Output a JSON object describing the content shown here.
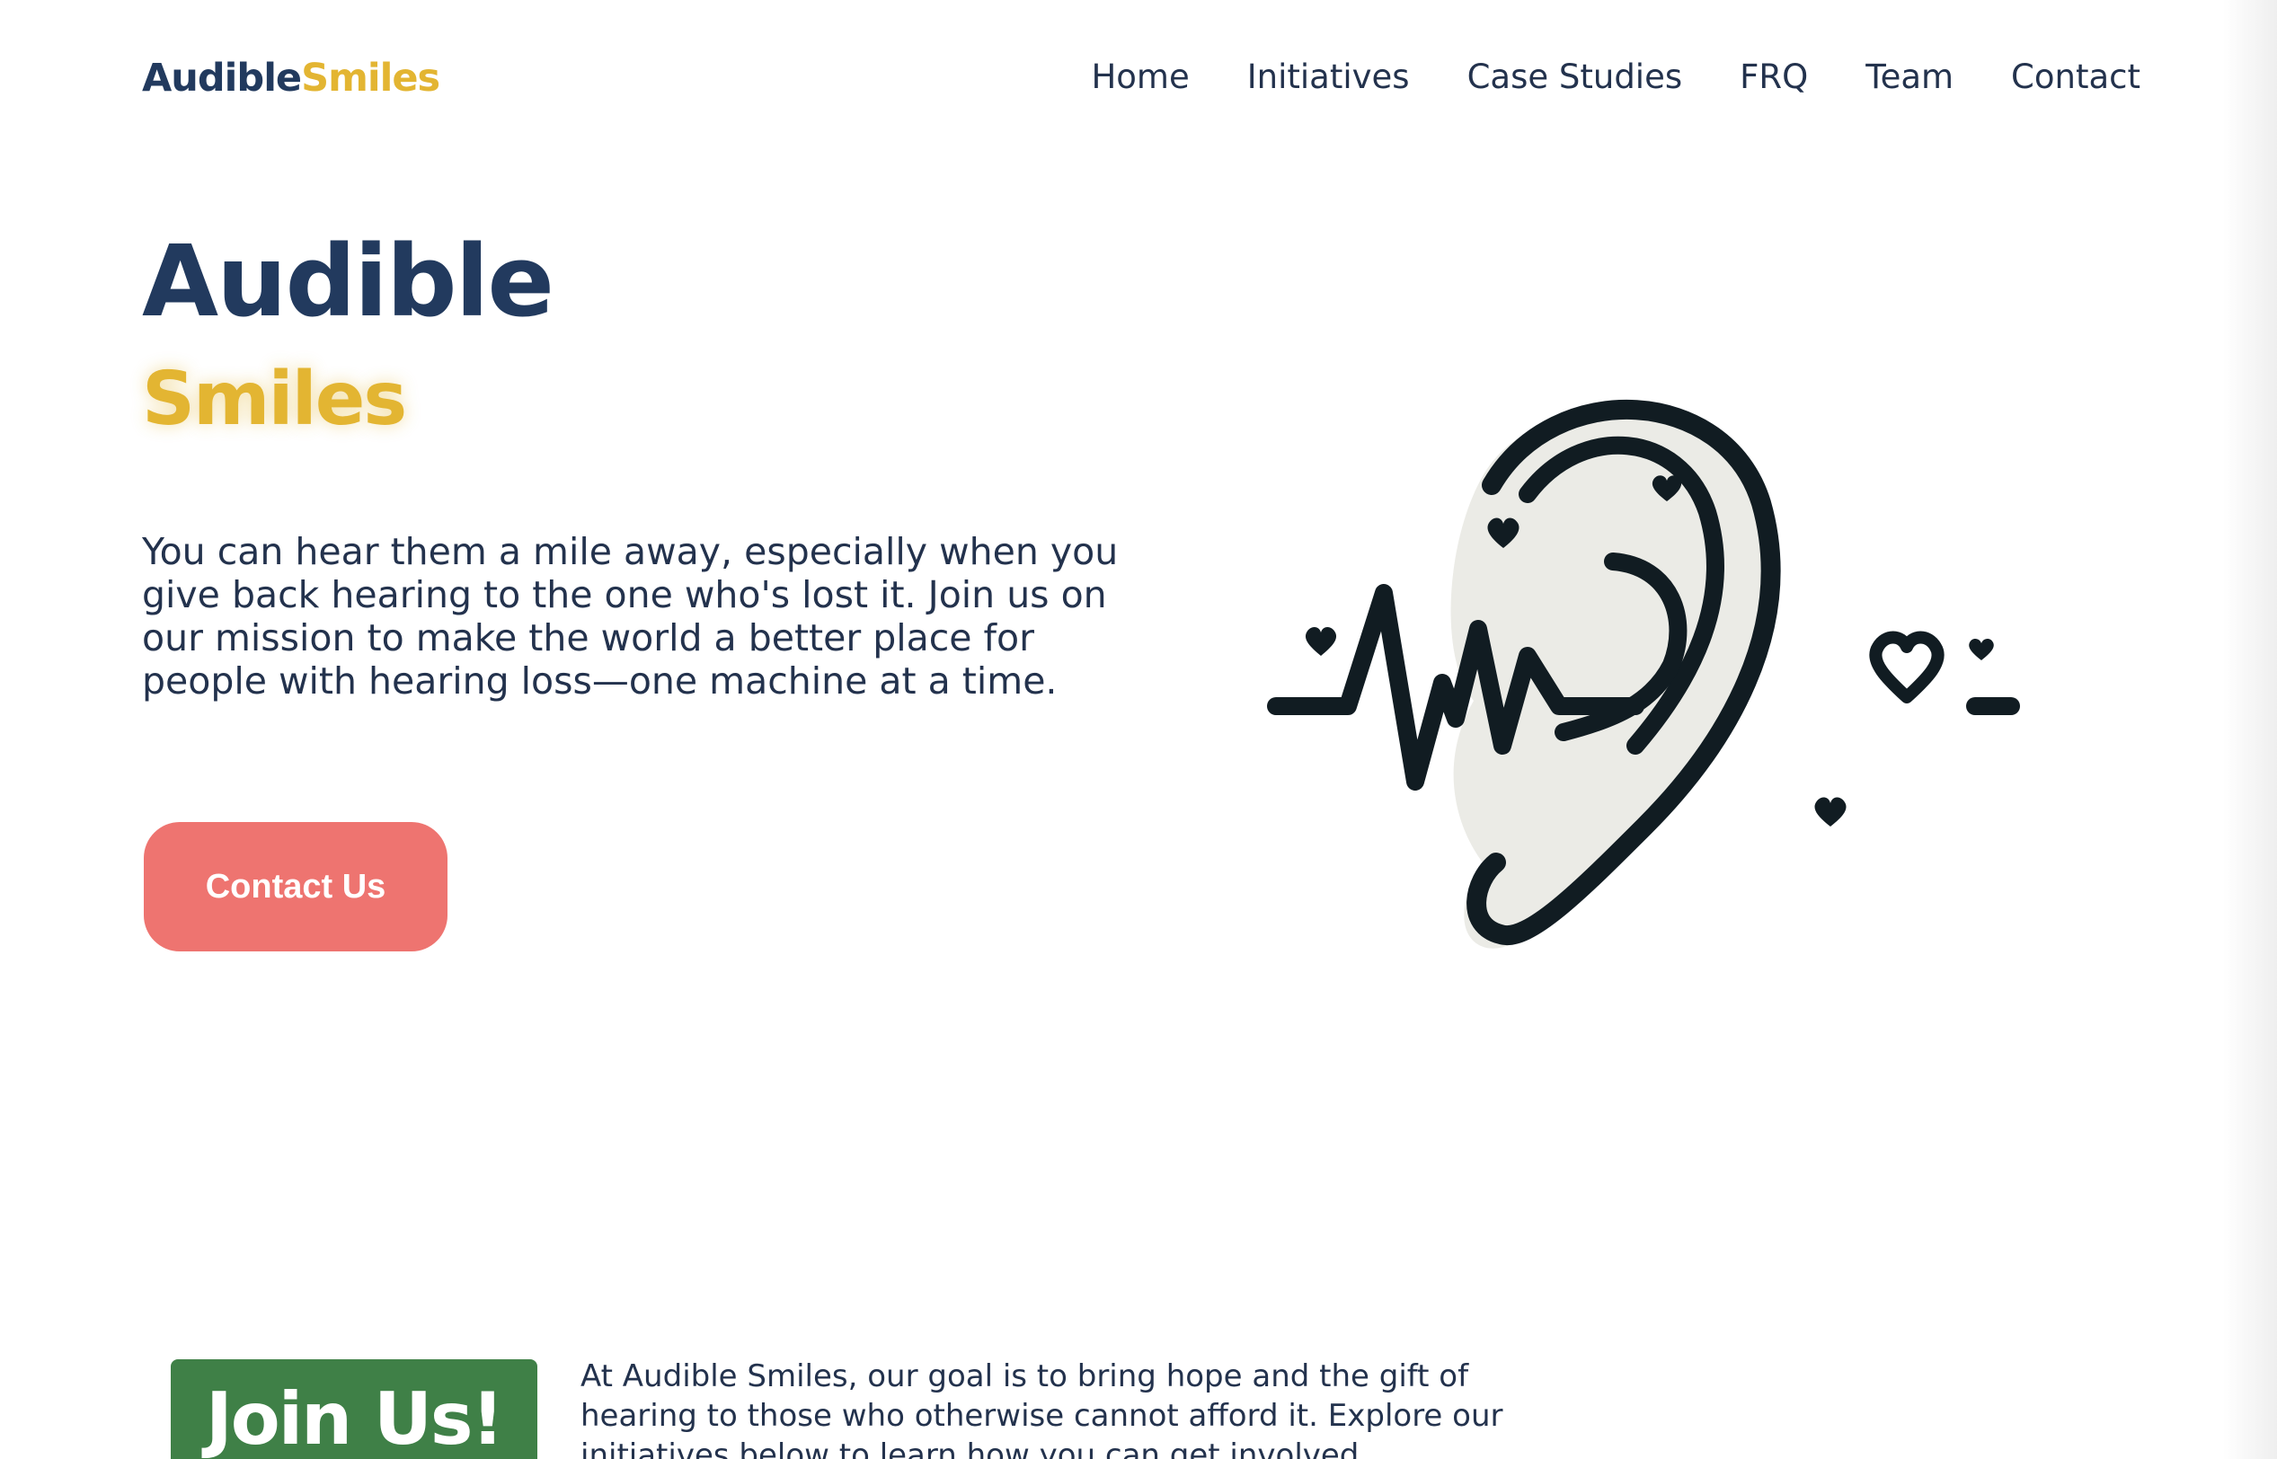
{
  "header": {
    "logo_part1": "Audible",
    "logo_part2": "Smiles",
    "nav": [
      {
        "label": "Home"
      },
      {
        "label": "Initiatives"
      },
      {
        "label": "Case Studies"
      },
      {
        "label": "FRQ"
      },
      {
        "label": "Team"
      },
      {
        "label": "Contact"
      }
    ]
  },
  "hero": {
    "title": "Audible",
    "subtitle": "Smiles",
    "text": "You can hear them a mile away, especially when you give back hearing to the one who's lost it. Join us on our mission to make the world a better place for people with hearing loss—one machine at a time.",
    "cta_label": "Contact Us",
    "illustration_icon": "ear-heartbeat-icon"
  },
  "join": {
    "badge": "Join Us!",
    "text": "At Audible Smiles, our goal is to bring hope and the gift of hearing to those who otherwise cannot afford it. Explore our initiatives below to learn how you can get involved."
  },
  "colors": {
    "navy": "#223a5e",
    "gold": "#e3b532",
    "coral": "#ee7470",
    "green": "#3f8047"
  }
}
